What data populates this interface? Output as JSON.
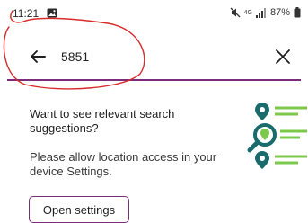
{
  "status_bar": {
    "time": "11:21",
    "battery": "87%",
    "network": "4G"
  },
  "search": {
    "value": "5851",
    "back_icon": "arrow-left-icon",
    "clear_icon": "close-icon"
  },
  "suggestions": {
    "title": "Want to see relevant search suggestions?",
    "body": "Please allow location access in your device Settings.",
    "button_label": "Open settings"
  },
  "colors": {
    "accent": "#7b2d7b",
    "teal": "#1a6b6b",
    "green": "#7cc84a",
    "annotation": "#d92b2b"
  }
}
